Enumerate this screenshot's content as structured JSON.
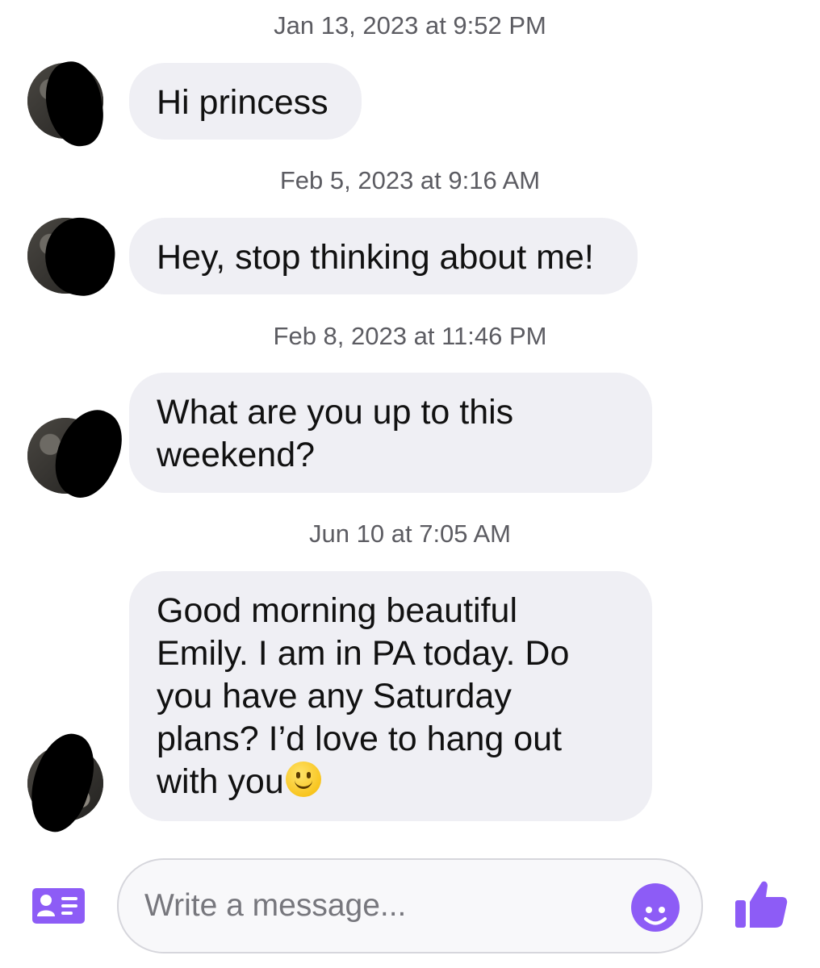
{
  "messages": [
    {
      "timestamp": "Jan 13, 2023 at 9:52 PM",
      "text": "Hi princess"
    },
    {
      "timestamp": "Feb 5, 2023 at 9:16 AM",
      "text": "Hey, stop thinking about me!"
    },
    {
      "timestamp": "Feb 8, 2023 at 11:46 PM",
      "lines": [
        "What are you up to this",
        "weekend?"
      ]
    },
    {
      "timestamp": "Jun 10 at 7:05 AM",
      "lines": [
        "Good morning beautiful",
        "Emily. I am in PA today. Do",
        "you have any Saturday",
        "plans? I’d love to hang out",
        "with you"
      ],
      "emoji": "slightly-smiling-face-emoji"
    }
  ],
  "composer": {
    "placeholder": "Write a message...",
    "contact_icon": "contact-card-icon",
    "emoji_icon": "smiley-icon",
    "send_icon": "thumbs-up-icon",
    "accent_color": "#8d5cf6"
  }
}
